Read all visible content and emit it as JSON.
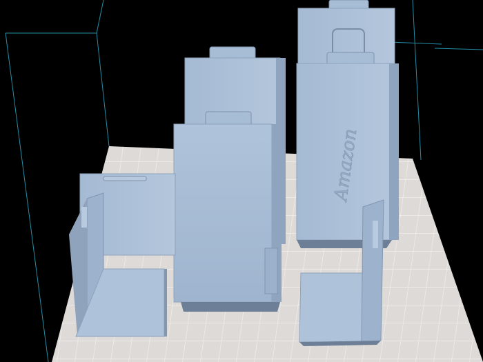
{
  "app": {
    "view": "3d-print-slicer-viewport"
  },
  "scene": {
    "background_color": "#000000",
    "build_plate_color": "#dedad7",
    "grid_line_color": "#f4f2f0",
    "bounding_box_color": "#2aa9c7",
    "part_color_light": "#a9bfd8",
    "part_color_mid": "#93a9c6",
    "part_color_dark": "#6d7f97",
    "embossed_text": "Amazon"
  }
}
